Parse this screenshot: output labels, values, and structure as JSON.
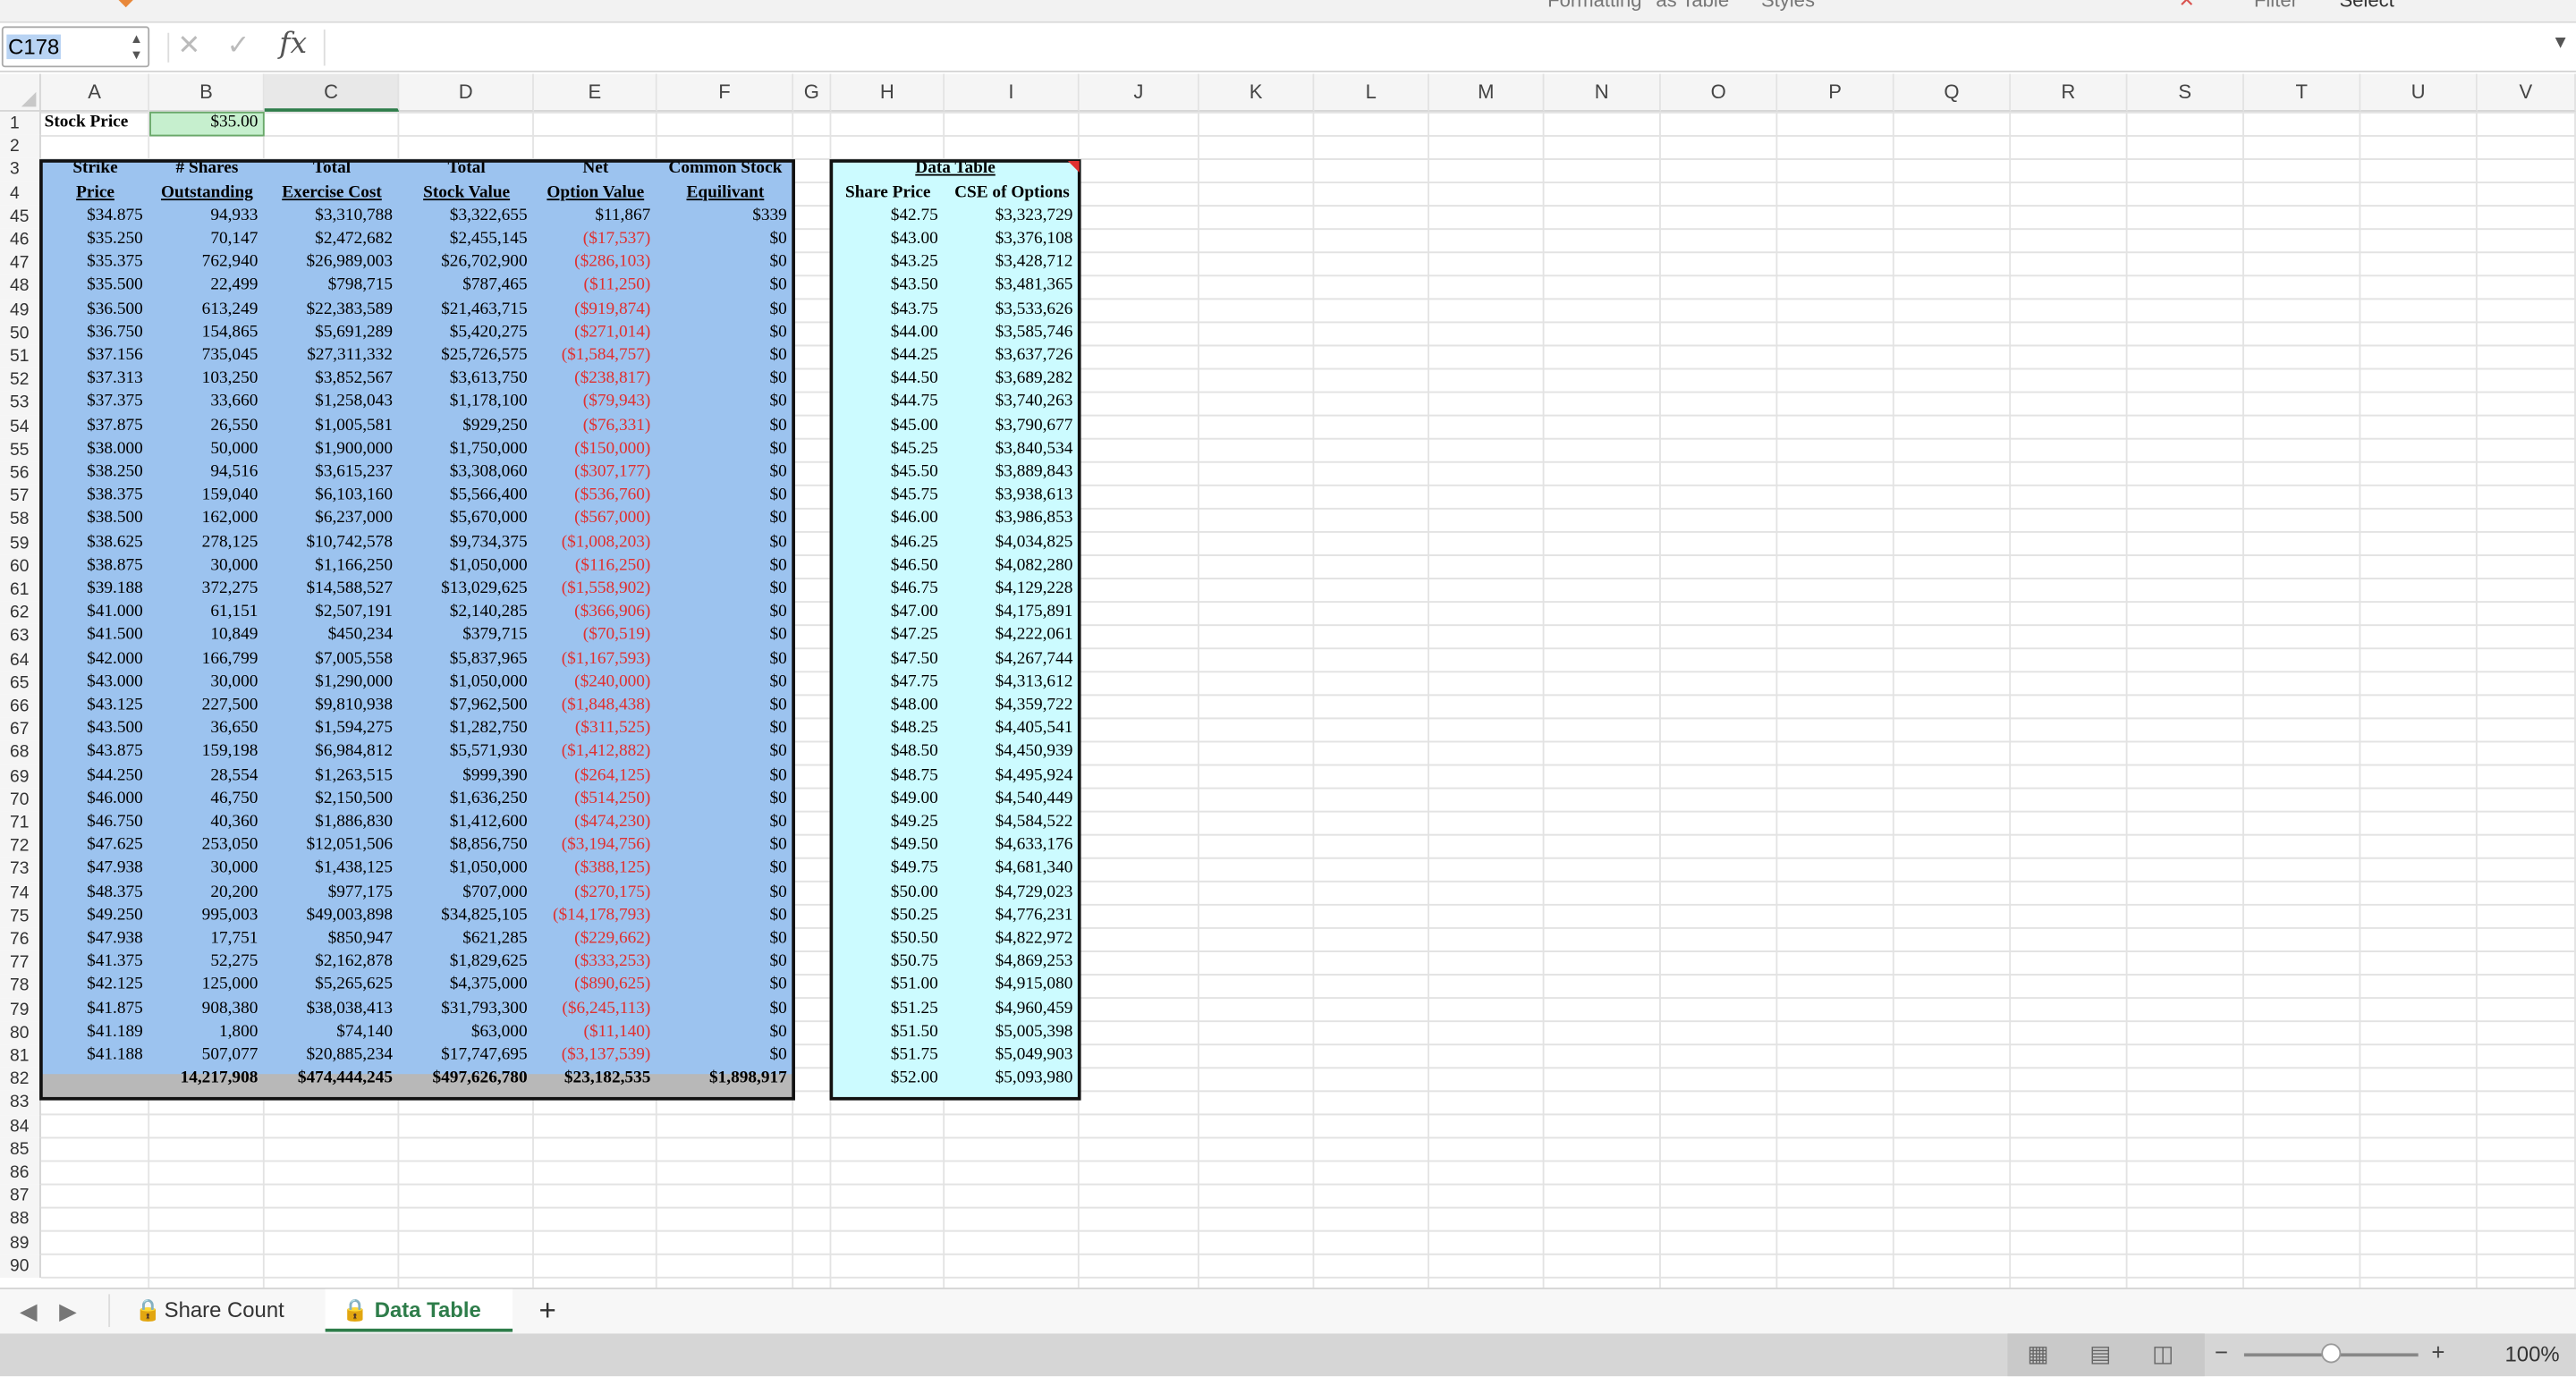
{
  "ribbon": {
    "items": [
      "Formatting",
      "as Table",
      "Styles",
      "Filter",
      "Select"
    ]
  },
  "formula_bar": {
    "name_box": "C178",
    "formula": "",
    "fx_label": "fx"
  },
  "columns": [
    "A",
    "B",
    "C",
    "D",
    "E",
    "F",
    "G",
    "H",
    "I",
    "J",
    "K",
    "L",
    "M",
    "N",
    "O",
    "P",
    "Q",
    "R",
    "S",
    "T",
    "U",
    "V"
  ],
  "top_rows": {
    "row1": {
      "label": "Stock Price",
      "value": "$35.00"
    },
    "headers_main": [
      {
        "line1": "Strike",
        "line2": "Price"
      },
      {
        "line1": "# Shares",
        "line2": "Outstanding"
      },
      {
        "line1": "Total",
        "line2": "Exercise Cost"
      },
      {
        "line1": "Total",
        "line2": "Stock Value"
      },
      {
        "line1": "Net",
        "line2": "Option Value"
      },
      {
        "line1": "Common Stock",
        "line2": "Equilivant"
      }
    ],
    "headers_dt": {
      "title": "Data Table",
      "col1": "Share Price",
      "col2": "CSE of Options"
    }
  },
  "rows": [
    [
      "45",
      "$34.875",
      "94,933",
      "$3,310,788",
      "$3,322,655",
      "$11,867",
      "$339",
      "$42.75",
      "$3,323,729"
    ],
    [
      "46",
      "$35.250",
      "70,147",
      "$2,472,682",
      "$2,455,145",
      "($17,537)",
      "$0",
      "$43.00",
      "$3,376,108"
    ],
    [
      "47",
      "$35.375",
      "762,940",
      "$26,989,003",
      "$26,702,900",
      "($286,103)",
      "$0",
      "$43.25",
      "$3,428,712"
    ],
    [
      "48",
      "$35.500",
      "22,499",
      "$798,715",
      "$787,465",
      "($11,250)",
      "$0",
      "$43.50",
      "$3,481,365"
    ],
    [
      "49",
      "$36.500",
      "613,249",
      "$22,383,589",
      "$21,463,715",
      "($919,874)",
      "$0",
      "$43.75",
      "$3,533,626"
    ],
    [
      "50",
      "$36.750",
      "154,865",
      "$5,691,289",
      "$5,420,275",
      "($271,014)",
      "$0",
      "$44.00",
      "$3,585,746"
    ],
    [
      "51",
      "$37.156",
      "735,045",
      "$27,311,332",
      "$25,726,575",
      "($1,584,757)",
      "$0",
      "$44.25",
      "$3,637,726"
    ],
    [
      "52",
      "$37.313",
      "103,250",
      "$3,852,567",
      "$3,613,750",
      "($238,817)",
      "$0",
      "$44.50",
      "$3,689,282"
    ],
    [
      "53",
      "$37.375",
      "33,660",
      "$1,258,043",
      "$1,178,100",
      "($79,943)",
      "$0",
      "$44.75",
      "$3,740,263"
    ],
    [
      "54",
      "$37.875",
      "26,550",
      "$1,005,581",
      "$929,250",
      "($76,331)",
      "$0",
      "$45.00",
      "$3,790,677"
    ],
    [
      "55",
      "$38.000",
      "50,000",
      "$1,900,000",
      "$1,750,000",
      "($150,000)",
      "$0",
      "$45.25",
      "$3,840,534"
    ],
    [
      "56",
      "$38.250",
      "94,516",
      "$3,615,237",
      "$3,308,060",
      "($307,177)",
      "$0",
      "$45.50",
      "$3,889,843"
    ],
    [
      "57",
      "$38.375",
      "159,040",
      "$6,103,160",
      "$5,566,400",
      "($536,760)",
      "$0",
      "$45.75",
      "$3,938,613"
    ],
    [
      "58",
      "$38.500",
      "162,000",
      "$6,237,000",
      "$5,670,000",
      "($567,000)",
      "$0",
      "$46.00",
      "$3,986,853"
    ],
    [
      "59",
      "$38.625",
      "278,125",
      "$10,742,578",
      "$9,734,375",
      "($1,008,203)",
      "$0",
      "$46.25",
      "$4,034,825"
    ],
    [
      "60",
      "$38.875",
      "30,000",
      "$1,166,250",
      "$1,050,000",
      "($116,250)",
      "$0",
      "$46.50",
      "$4,082,280"
    ],
    [
      "61",
      "$39.188",
      "372,275",
      "$14,588,527",
      "$13,029,625",
      "($1,558,902)",
      "$0",
      "$46.75",
      "$4,129,228"
    ],
    [
      "62",
      "$41.000",
      "61,151",
      "$2,507,191",
      "$2,140,285",
      "($366,906)",
      "$0",
      "$47.00",
      "$4,175,891"
    ],
    [
      "63",
      "$41.500",
      "10,849",
      "$450,234",
      "$379,715",
      "($70,519)",
      "$0",
      "$47.25",
      "$4,222,061"
    ],
    [
      "64",
      "$42.000",
      "166,799",
      "$7,005,558",
      "$5,837,965",
      "($1,167,593)",
      "$0",
      "$47.50",
      "$4,267,744"
    ],
    [
      "65",
      "$43.000",
      "30,000",
      "$1,290,000",
      "$1,050,000",
      "($240,000)",
      "$0",
      "$47.75",
      "$4,313,612"
    ],
    [
      "66",
      "$43.125",
      "227,500",
      "$9,810,938",
      "$7,962,500",
      "($1,848,438)",
      "$0",
      "$48.00",
      "$4,359,722"
    ],
    [
      "67",
      "$43.500",
      "36,650",
      "$1,594,275",
      "$1,282,750",
      "($311,525)",
      "$0",
      "$48.25",
      "$4,405,541"
    ],
    [
      "68",
      "$43.875",
      "159,198",
      "$6,984,812",
      "$5,571,930",
      "($1,412,882)",
      "$0",
      "$48.50",
      "$4,450,939"
    ],
    [
      "69",
      "$44.250",
      "28,554",
      "$1,263,515",
      "$999,390",
      "($264,125)",
      "$0",
      "$48.75",
      "$4,495,924"
    ],
    [
      "70",
      "$46.000",
      "46,750",
      "$2,150,500",
      "$1,636,250",
      "($514,250)",
      "$0",
      "$49.00",
      "$4,540,449"
    ],
    [
      "71",
      "$46.750",
      "40,360",
      "$1,886,830",
      "$1,412,600",
      "($474,230)",
      "$0",
      "$49.25",
      "$4,584,522"
    ],
    [
      "72",
      "$47.625",
      "253,050",
      "$12,051,506",
      "$8,856,750",
      "($3,194,756)",
      "$0",
      "$49.50",
      "$4,633,176"
    ],
    [
      "73",
      "$47.938",
      "30,000",
      "$1,438,125",
      "$1,050,000",
      "($388,125)",
      "$0",
      "$49.75",
      "$4,681,340"
    ],
    [
      "74",
      "$48.375",
      "20,200",
      "$977,175",
      "$707,000",
      "($270,175)",
      "$0",
      "$50.00",
      "$4,729,023"
    ],
    [
      "75",
      "$49.250",
      "995,003",
      "$49,003,898",
      "$34,825,105",
      "($14,178,793)",
      "$0",
      "$50.25",
      "$4,776,231"
    ],
    [
      "76",
      "$47.938",
      "17,751",
      "$850,947",
      "$621,285",
      "($229,662)",
      "$0",
      "$50.50",
      "$4,822,972"
    ],
    [
      "77",
      "$41.375",
      "52,275",
      "$2,162,878",
      "$1,829,625",
      "($333,253)",
      "$0",
      "$50.75",
      "$4,869,253"
    ],
    [
      "78",
      "$42.125",
      "125,000",
      "$5,265,625",
      "$4,375,000",
      "($890,625)",
      "$0",
      "$51.00",
      "$4,915,080"
    ],
    [
      "79",
      "$41.875",
      "908,380",
      "$38,038,413",
      "$31,793,300",
      "($6,245,113)",
      "$0",
      "$51.25",
      "$4,960,459"
    ],
    [
      "80",
      "$41.189",
      "1,800",
      "$74,140",
      "$63,000",
      "($11,140)",
      "$0",
      "$51.50",
      "$5,005,398"
    ],
    [
      "81",
      "$41.188",
      "507,077",
      "$20,885,234",
      "$17,747,695",
      "($3,137,539)",
      "$0",
      "$51.75",
      "$5,049,903"
    ]
  ],
  "totals_row": {
    "row": "82",
    "shares": "14,217,908",
    "exercise": "$474,444,245",
    "stock_value": "$497,626,780",
    "net": "$23,182,535",
    "cse": "$1,898,917",
    "dt_price": "$52.00",
    "dt_cse": "$5,093,980"
  },
  "empty_rows": [
    "83",
    "84",
    "85",
    "86",
    "87",
    "88",
    "89",
    "90"
  ],
  "header_row_labels": [
    "1",
    "2",
    "3",
    "4"
  ],
  "sheet_tabs": [
    {
      "label": "Share Count",
      "active": false
    },
    {
      "label": "Data Table",
      "active": true
    }
  ],
  "add_sheet": "+",
  "zoom": {
    "label": "100%",
    "level": 100
  },
  "colors": {
    "selected_fill": "#9cc3ef",
    "data_table_fill": "#ccfbff",
    "stock_price_fill": "#c6efce",
    "negative": "#e0302f",
    "active_tab": "#2e7d4a"
  }
}
